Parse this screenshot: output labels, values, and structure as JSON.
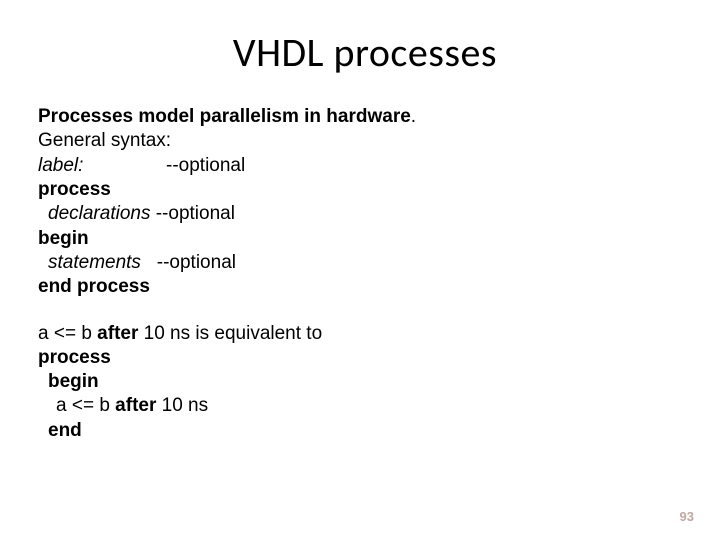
{
  "title": "VHDL processes",
  "s1": {
    "l0a": "Processes model parallelism in hardware",
    "l0b": ".",
    "l1": "General syntax:",
    "l2a": "label:",
    "l2b": "--optional",
    "l3": "process",
    "l4a": "declarations",
    "l4b": " --optional",
    "l5": "begin",
    "l6a": "statements",
    "l6b": "   --optional",
    "l7": "end process"
  },
  "s2": {
    "l0a": "a <= b ",
    "l0b": "after",
    "l0c": " 10 ns is equivalent to",
    "l1": "process",
    "l2": "begin",
    "l3a": "a <= b ",
    "l3b": "after",
    "l3c": " 10 ns",
    "l4": "end"
  },
  "pagenum": "93"
}
